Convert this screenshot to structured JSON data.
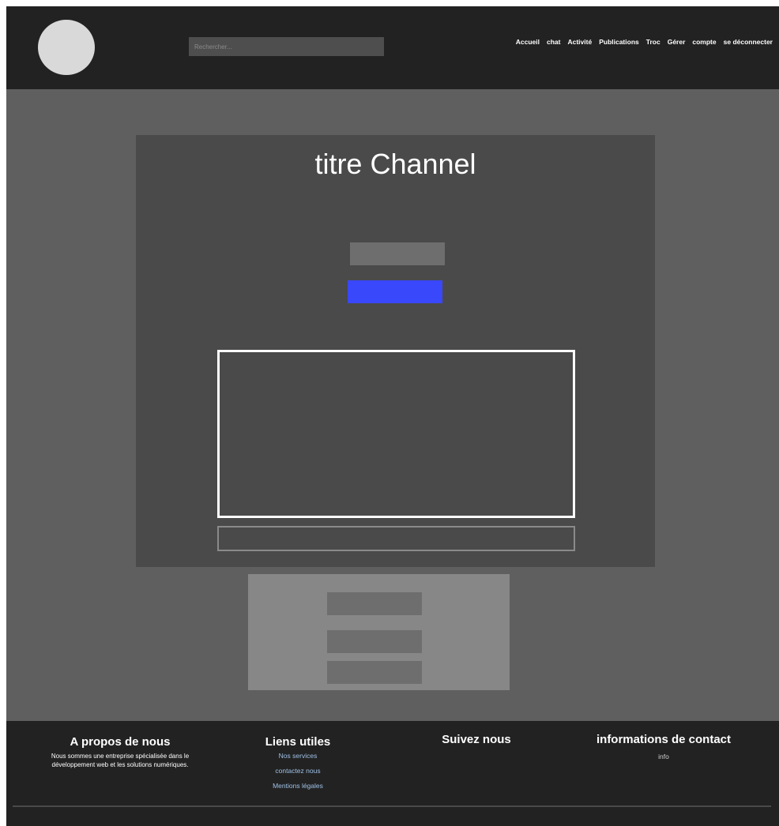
{
  "header": {
    "search_placeholder": "Rechercher...",
    "nav": [
      "Accueil",
      "chat",
      "Activité",
      "Publications",
      "Troc",
      "Gérer",
      "compte",
      "se déconnecter"
    ]
  },
  "channel": {
    "title": "titre Channel"
  },
  "colors": {
    "accent_button": "#3a48fc"
  },
  "footer": {
    "about": {
      "title": "A propos de nous",
      "text": "Nous sommes une entreprise spécialisée dans le développement web et les solutions numériques."
    },
    "links": {
      "title": "Liens utiles",
      "items": [
        "Nos services",
        "contactez nous",
        "Mentions légales"
      ]
    },
    "follow": {
      "title": "Suivez nous"
    },
    "contact": {
      "title": "informations de contact",
      "info": "info"
    }
  }
}
